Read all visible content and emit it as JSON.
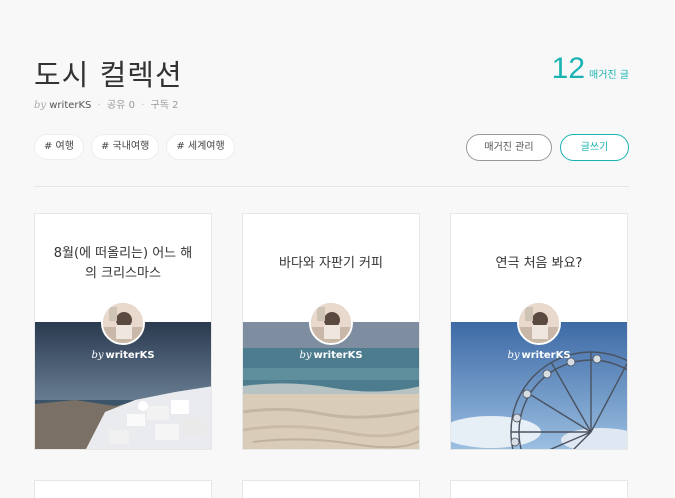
{
  "magazine": {
    "title": "도시 컬렉션",
    "by": "by",
    "author": "writerKS",
    "share": "공유 0",
    "subscribe": "구독 2"
  },
  "count": {
    "number": "12",
    "label": "매거진 글"
  },
  "tags": [
    "# 여행",
    "# 국내여행",
    "# 세계여행"
  ],
  "buttons": {
    "manage": "매거진 관리",
    "write": "글쓰기"
  },
  "cards": [
    {
      "title": "8월(에 떠올리는) 어느 해의 크리스마스",
      "by": "by",
      "author": "writerKS",
      "image": "santorini"
    },
    {
      "title": "바다와 자판기 커피",
      "by": "by",
      "author": "writerKS",
      "image": "beach"
    },
    {
      "title": "연극 처음 봐요?",
      "by": "by",
      "author": "writerKS",
      "image": "ferris-wheel"
    }
  ],
  "colors": {
    "accent": "#19b3b3"
  }
}
